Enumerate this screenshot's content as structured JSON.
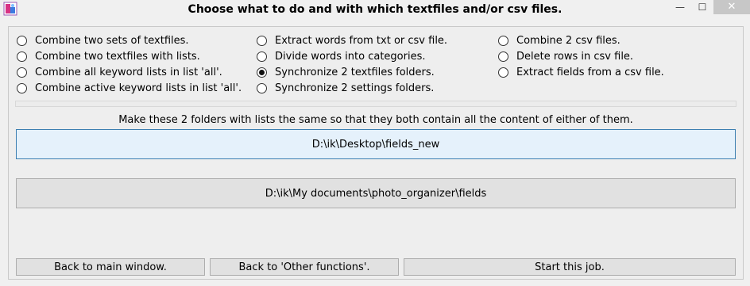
{
  "window": {
    "title": "Choose what to do and with which textfiles and/or csv files.",
    "minimize_glyph": "—",
    "maximize_glyph": "☐",
    "close_glyph": "✕",
    "icon": "app-logo-icon"
  },
  "options": {
    "col1": [
      {
        "label": "Combine two sets of textfiles.",
        "checked": false
      },
      {
        "label": "Combine two textfiles with lists.",
        "checked": false
      },
      {
        "label": "Combine all keyword lists in list 'all'.",
        "checked": false
      },
      {
        "label": "Combine active keyword lists in list 'all'.",
        "checked": false
      }
    ],
    "col2": [
      {
        "label": "Extract words from txt or csv file.",
        "checked": false
      },
      {
        "label": "Divide words into categories.",
        "checked": false
      },
      {
        "label": "Synchronize 2 textfiles folders.",
        "checked": true
      },
      {
        "label": "Synchronize 2 settings folders.",
        "checked": false
      }
    ],
    "col3": [
      {
        "label": "Combine 2 csv files.",
        "checked": false
      },
      {
        "label": "Delete rows in csv file.",
        "checked": false
      },
      {
        "label": "Extract fields from a csv file.",
        "checked": false
      }
    ]
  },
  "description": "Make these 2 folders with lists the same so that they both contain all the content of either of them.",
  "folders": {
    "first": "D:\\ik\\Desktop\\fields_new",
    "second": "D:\\ik\\My documents\\photo_organizer\\fields"
  },
  "buttons": {
    "back_main": "Back to main window.",
    "back_other": "Back to 'Other functions'.",
    "start": "Start this job."
  }
}
